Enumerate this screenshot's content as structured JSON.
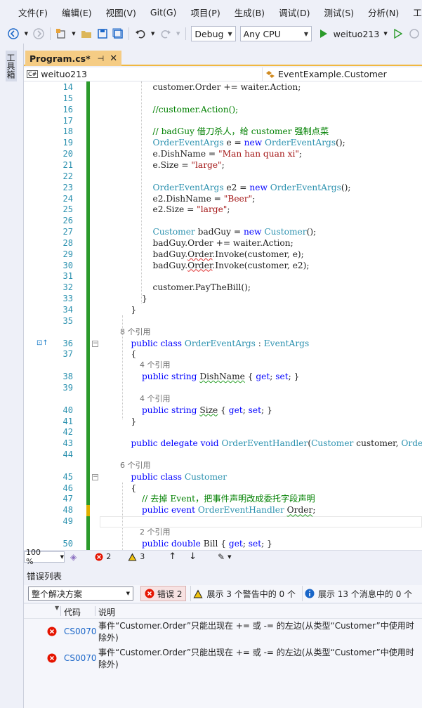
{
  "menu": {
    "items": [
      "文件(F)",
      "编辑(E)",
      "视图(V)",
      "Git(G)",
      "项目(P)",
      "生成(B)",
      "调试(D)",
      "测试(S)",
      "分析(N)",
      "工具"
    ]
  },
  "toolbar": {
    "configuration": "Debug",
    "platform": "Any CPU",
    "run_target": "weituo213"
  },
  "left_strip": {
    "toolbox_label": "工具箱"
  },
  "document_tab": {
    "title": "Program.cs*",
    "pin": "⊣",
    "close": "✕"
  },
  "navbar": {
    "project": "weituo213",
    "type": "EventExample.Customer"
  },
  "editor": {
    "lines": [
      {
        "n": "14",
        "html": "            customer.Order += waiter.Action;"
      },
      {
        "n": "15",
        "html": ""
      },
      {
        "n": "16",
        "html": "            <span class=\"cm\">//customer.Action();</span>"
      },
      {
        "n": "17",
        "html": ""
      },
      {
        "n": "18",
        "html": "            <span class=\"cm\">// badGuy 借刀杀人，给 customer 强制点菜</span>"
      },
      {
        "n": "19",
        "html": "            <span class=\"ty\">OrderEventArgs</span> e = <span class=\"kw\">new</span> <span class=\"ty\">OrderEventArgs</span>();"
      },
      {
        "n": "20",
        "html": "            e.DishName = <span class=\"st\">\"Man han quan xi\"</span>;"
      },
      {
        "n": "21",
        "html": "            e.Size = <span class=\"st\">\"large\"</span>;"
      },
      {
        "n": "22",
        "html": ""
      },
      {
        "n": "23",
        "html": "            <span class=\"ty\">OrderEventArgs</span> e2 = <span class=\"kw\">new</span> <span class=\"ty\">OrderEventArgs</span>();"
      },
      {
        "n": "24",
        "html": "            e2.DishName = <span class=\"st\">\"Beer\"</span>;"
      },
      {
        "n": "25",
        "html": "            e2.Size = <span class=\"st\">\"large\"</span>;"
      },
      {
        "n": "26",
        "html": ""
      },
      {
        "n": "27",
        "html": "            <span class=\"ty\">Customer</span> badGuy = <span class=\"kw\">new</span> <span class=\"ty\">Customer</span>();"
      },
      {
        "n": "28",
        "html": "            badGuy.Order += waiter.Action;"
      },
      {
        "n": "29",
        "html": "            badGuy.<span class=\"sq\">Order</span>.Invoke(customer, e);"
      },
      {
        "n": "30",
        "html": "            badGuy.<span class=\"sq\">Order</span>.Invoke(customer, e2);"
      },
      {
        "n": "31",
        "html": ""
      },
      {
        "n": "32",
        "html": "            customer.PayTheBill();"
      },
      {
        "n": "33",
        "html": "        }"
      },
      {
        "n": "34",
        "html": "    }"
      },
      {
        "n": "35",
        "html": ""
      },
      {
        "n": "",
        "refs": "8 个引用"
      },
      {
        "n": "36",
        "html": "    <span class=\"kw\">public</span> <span class=\"kw\">class</span> <span class=\"ty\">OrderEventArgs</span> : <span class=\"ty\">EventArgs</span>",
        "fold": "−",
        "marker": "⊡↑"
      },
      {
        "n": "37",
        "html": "    {"
      },
      {
        "n": "",
        "refs": "        4 个引用"
      },
      {
        "n": "38",
        "html": "        <span class=\"kw\">public</span> <span class=\"kw\">string</span> <span class=\"sqg\">DishName</span> { <span class=\"kw\">get</span>; <span class=\"kw\">set</span>; }"
      },
      {
        "n": "39",
        "html": ""
      },
      {
        "n": "",
        "refs": "        4 个引用"
      },
      {
        "n": "40",
        "html": "        <span class=\"kw\">public</span> <span class=\"kw\">string</span> <span class=\"sqg\">Size</span> { <span class=\"kw\">get</span>; <span class=\"kw\">set</span>; }"
      },
      {
        "n": "41",
        "html": "    }"
      },
      {
        "n": "42",
        "html": ""
      },
      {
        "n": "43",
        "html": "    <span class=\"kw\">public</span> <span class=\"kw\">delegate</span> <span class=\"kw\">void</span> <span class=\"ty\">OrderEventHandler</span>(<span class=\"ty\">Customer</span> customer, <span class=\"ty\">Orde</span>"
      },
      {
        "n": "44",
        "html": ""
      },
      {
        "n": "",
        "refs": "6 个引用"
      },
      {
        "n": "45",
        "html": "    <span class=\"kw\">public</span> <span class=\"kw\">class</span> <span class=\"ty\">Customer</span>",
        "fold": "−"
      },
      {
        "n": "46",
        "html": "    {"
      },
      {
        "n": "47",
        "html": "        <span class=\"cm\">// 去掉 Event，把事件声明改成委托字段声明</span>"
      },
      {
        "n": "48",
        "html": "        <span class=\"kw\">public</span> <span class=\"kw\">event</span> <span class=\"ty\">OrderEventHandler</span> <span class=\"sqg\">Order</span>;"
      },
      {
        "n": "49",
        "html": ""
      },
      {
        "n": "",
        "refs": "        2 个引用"
      },
      {
        "n": "50",
        "html": "        <span class=\"kw\">public</span> <span class=\"kw\">double</span> Bill { <span class=\"kw\">get</span>; <span class=\"kw\">set</span>; }"
      }
    ]
  },
  "editor_status": {
    "zoom": "100 %",
    "errors": "2",
    "warnings": "3"
  },
  "error_list": {
    "title": "错误列表",
    "scope": "整个解决方案",
    "errors_button": "错误 2",
    "warnings_button": "展示 3 个警告中的 0 个",
    "messages_button": "展示 13 个消息中的 0 个",
    "columns": {
      "code": "代码",
      "description": "说明"
    },
    "rows": [
      {
        "code": "CS0070",
        "description": "事件“Customer.Order”只能出现在 += 或 -= 的左边(从类型“Customer”中使用时除外)"
      },
      {
        "code": "CS0070",
        "description": "事件“Customer.Order”只能出现在 += 或 -= 的左边(从类型“Customer”中使用时除外)"
      }
    ]
  },
  "colors": {
    "accent_tab": "#f5cc84",
    "change_bar": "#2b9a2b",
    "error_red": "#e51400",
    "keyword_blue": "#0000ff",
    "type_teal": "#2b91af",
    "comment_green": "#008000",
    "string_red": "#a31515"
  }
}
